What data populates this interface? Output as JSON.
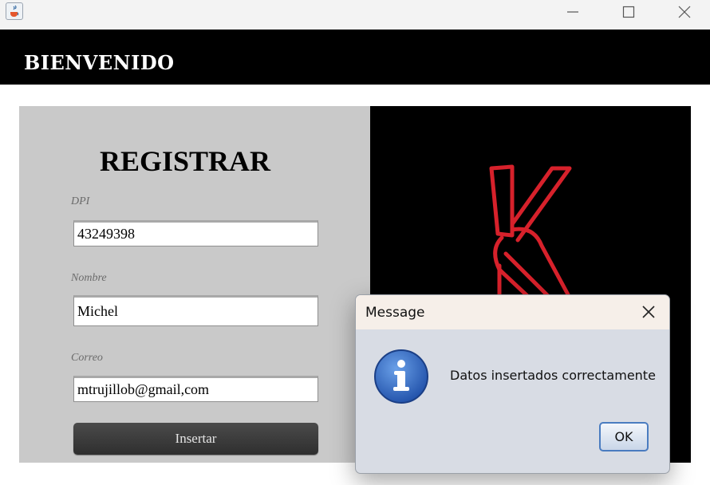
{
  "window": {
    "icon": "java-cup-icon",
    "controls": [
      "minimize-icon",
      "maximize-icon",
      "close-icon"
    ]
  },
  "header": {
    "title": "BIENVENIDO"
  },
  "form": {
    "title": "REGISTRAR",
    "fields": [
      {
        "label": "DPI",
        "value": "43249398"
      },
      {
        "label": "Nombre",
        "value": "Michel"
      },
      {
        "label": "Correo",
        "value": "mtrujillob@gmail,com"
      }
    ],
    "submit_label": "Insertar"
  },
  "logo": {
    "icon": "k-logo-icon",
    "color": "#d7212b"
  },
  "dialog": {
    "title": "Message",
    "message": "Datos insertados correctamente",
    "ok_label": "OK",
    "icon": "info-icon"
  }
}
